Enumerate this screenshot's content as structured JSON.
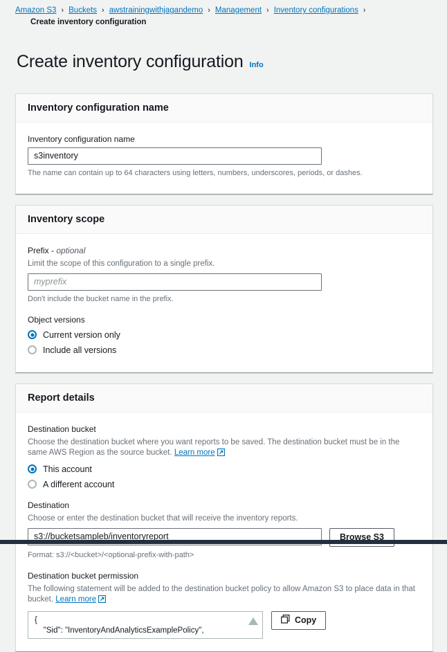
{
  "breadcrumb": {
    "links": [
      {
        "label": "Amazon S3"
      },
      {
        "label": "Buckets"
      },
      {
        "label": "awstrainingwithjagandemo"
      },
      {
        "label": "Management"
      },
      {
        "label": "Inventory configurations"
      }
    ],
    "separator": "›",
    "current": "Create inventory configuration"
  },
  "page": {
    "title": "Create inventory configuration",
    "info_label": "Info"
  },
  "sections": {
    "name": {
      "heading": "Inventory configuration name",
      "field_label": "Inventory configuration name",
      "input_value": "s3inventory",
      "hint": "The name can contain up to 64 characters using letters, numbers, underscores, periods, or dashes."
    },
    "scope": {
      "heading": "Inventory scope",
      "prefix_label": "Prefix - ",
      "prefix_label_optional": "optional",
      "prefix_desc": "Limit the scope of this configuration to a single prefix.",
      "prefix_placeholder": "myprefix",
      "prefix_hint": "Don't include the bucket name in the prefix.",
      "object_versions_label": "Object versions",
      "options": [
        {
          "label": "Current version only",
          "selected": true
        },
        {
          "label": "Include all versions",
          "selected": false
        }
      ]
    },
    "report": {
      "heading": "Report details",
      "destination_bucket_label": "Destination bucket",
      "destination_bucket_desc": "Choose the destination bucket where you want reports to be saved. The destination bucket must be in the same AWS Region as the source bucket.",
      "learn_more_label": "Learn more",
      "account_options": [
        {
          "label": "This account",
          "selected": true
        },
        {
          "label": "A different account",
          "selected": false
        }
      ],
      "destination_label": "Destination",
      "destination_desc": "Choose or enter the destination bucket that will receive the inventory reports.",
      "destination_value": "s3://bucketsampleb/inventoryreport",
      "browse_button": "Browse S3",
      "destination_format_hint": "Format: s3://<bucket>/<optional-prefix-with-path>",
      "permission_label": "Destination bucket permission",
      "permission_desc": "The following statement will be added to the destination bucket policy to allow Amazon S3 to place data in that bucket.",
      "permission_learn_more": "Learn more",
      "policy_code": "{\n    \"Sid\": \"InventoryAndAnalyticsExamplePolicy\",",
      "copy_button": "Copy"
    }
  },
  "colors": {
    "link": "#0073bb",
    "page_bg": "#f1f3f3",
    "card_bg": "#ffffff",
    "bottom_bar": "#232f3e"
  }
}
